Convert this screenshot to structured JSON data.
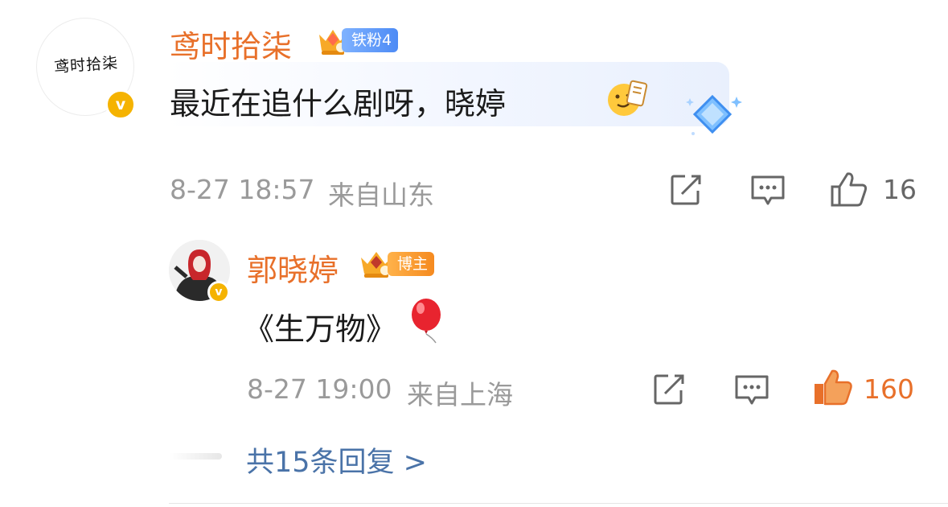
{
  "comment": {
    "username": "鸢时拾柒",
    "avatar_text": "鸢时拾柒",
    "badge_label": "铁粉4",
    "text": "最近在追什么剧呀，晓婷",
    "timestamp": "8-27 18:57",
    "location": "来自山东",
    "likes": "16"
  },
  "reply": {
    "username": "郭晓婷",
    "badge_label": "博主",
    "text": "《生万物》",
    "emoji": "🎈",
    "timestamp": "8-27 19:00",
    "location": "来自上海",
    "likes": "160"
  },
  "more_replies": "共15条回复 >",
  "colors": {
    "name": "#e8702a",
    "meta": "#9a9a9a",
    "link": "#4a73a8",
    "liked": "#e8702a",
    "verified": "#f5b301",
    "fan_badge": "#4d8bf5",
    "owner_badge": "#f58a1f"
  },
  "icons": [
    "share-icon",
    "comment-icon",
    "like-icon",
    "liked-icon",
    "diamond-icon",
    "crown-icon",
    "verified-icon",
    "balloon-icon"
  ]
}
